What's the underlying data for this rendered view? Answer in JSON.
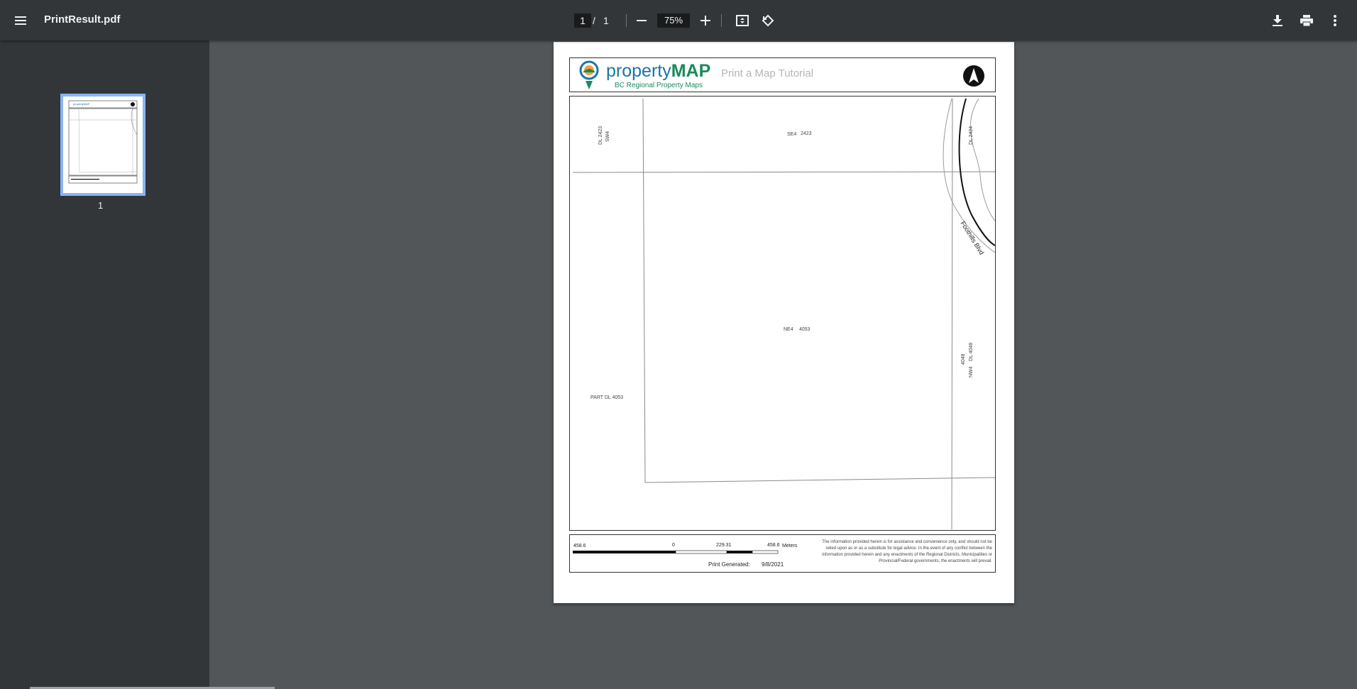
{
  "toolbar": {
    "menu_icon": "hamburger-menu-icon",
    "file_name": "PrintResult.pdf",
    "current_page": "1",
    "page_separator": "/",
    "total_pages": "1",
    "zoom_level": "75%"
  },
  "sidebar": {
    "thumbnails": [
      {
        "label": "1",
        "selected": true
      }
    ]
  },
  "document": {
    "logo_brand_lower": "property",
    "logo_brand_upper": "MAP",
    "logo_tagline": "BC Regional Property Maps",
    "map_title": "Print a Map Tutorial",
    "map_labels": {
      "dl2423_top": "DL 2423",
      "sw4": "SW4",
      "se4": "SE4",
      "se4_num": "2423",
      "dl2424": "DL 2424",
      "road": "Foothills Blvd",
      "ne4": "NE4",
      "ne4_num": "4053",
      "part_dl": "PART DL 4053",
      "dl4048_num": "4048",
      "nw4": "NW4",
      "dl4048": "DL 4048"
    },
    "scale": {
      "left": "458.6",
      "zero": "0",
      "mid": "229.31",
      "right": "458.6",
      "unit": "Meters"
    },
    "print_generated_label": "Print Generated:",
    "print_generated_date": "9/8/2021",
    "disclaimer": "The information provided herein is for assistance and convenience only, and should not be relied upon as or as a substitute for legal advice. In the event of any conflict between the information provided herein and any enactments of the Regional Districts, Municipalities or Provincial/Federal governments, the enactments will prevail."
  },
  "colors": {
    "toolbar_bg": "#323639",
    "viewer_bg": "#525659",
    "thumb_selected": "#8ab4f8",
    "logo_blue": "#1a75a6",
    "logo_green": "#1a8a5a"
  }
}
